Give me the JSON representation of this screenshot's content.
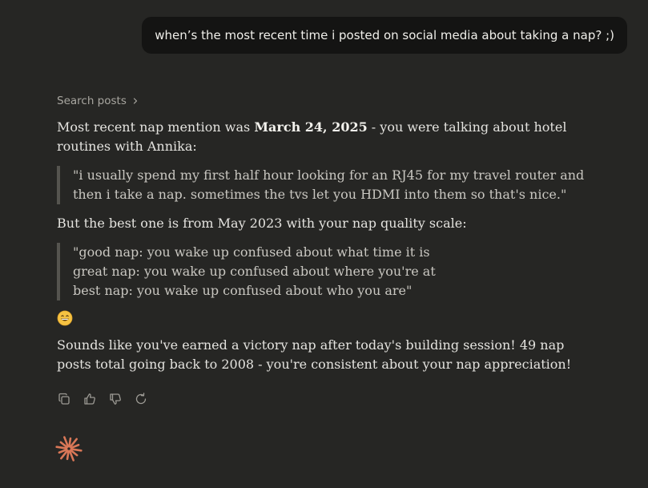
{
  "user_message": "when’s the most recent time i posted on social media about taking a nap? ;)",
  "tool": {
    "label": "Search posts",
    "icon": "chevron-right-icon"
  },
  "response": {
    "p1_before": "Most recent nap mention was ",
    "p1_bold": "March 24, 2025",
    "p1_after": " - you were talking about hotel routines with Annika:",
    "quote1": "\"i usually spend my first half hour looking for an RJ45 for my travel router and then i take a nap. sometimes the tvs let you HDMI into them so that's nice.\"",
    "p2": "But the best one is from May 2023 with your nap quality scale:",
    "quote2_lines": [
      "\"good nap: you wake up confused about what time it is",
      "great nap: you wake up confused about where you're at",
      "best nap: you wake up confused about who you are\""
    ],
    "emoji": "grinning-face-emoji",
    "p3": "Sounds like you've earned a victory nap after today's building session! 49 nap posts total going back to 2008 - you're consistent about your nap appreciation!"
  },
  "actions": [
    {
      "name": "copy-icon"
    },
    {
      "name": "thumbs-up-icon"
    },
    {
      "name": "thumbs-down-icon"
    },
    {
      "name": "retry-icon"
    }
  ],
  "brand": {
    "icon": "claude-spark-icon",
    "color": "#d97757"
  },
  "colors": {
    "background": "#262624",
    "bubble": "#141413",
    "accent": "#d97757"
  }
}
